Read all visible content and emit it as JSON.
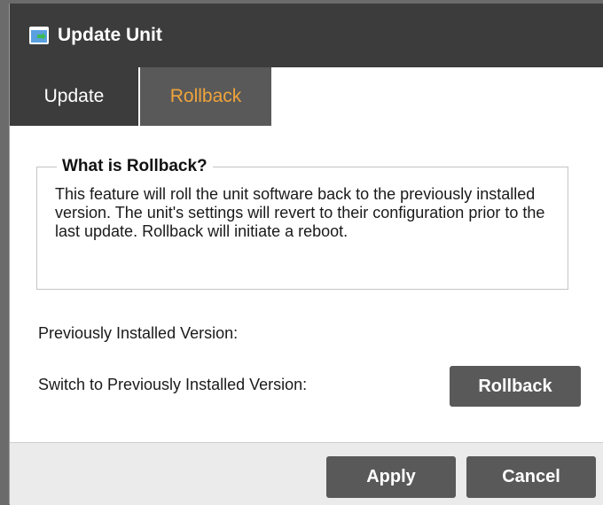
{
  "dialog": {
    "title": "Update Unit",
    "title_icon": "update-unit-icon"
  },
  "tabs": [
    {
      "label": "Update",
      "active": false
    },
    {
      "label": "Rollback",
      "active": true
    }
  ],
  "rollback": {
    "legend": "What is Rollback?",
    "description": "This feature will roll the unit software back to the previously installed version. The unit's settings will revert to their configuration prior to the last update. Rollback will initiate a reboot.",
    "previous_version_label": "Previously Installed Version:",
    "switch_label": "Switch to Previously Installed Version:",
    "rollback_button": "Rollback"
  },
  "footer": {
    "apply_label": "Apply",
    "cancel_label": "Cancel"
  },
  "colors": {
    "titlebar": "#3c3c3c",
    "active_tab_text": "#f0a43a",
    "button": "#595959"
  }
}
